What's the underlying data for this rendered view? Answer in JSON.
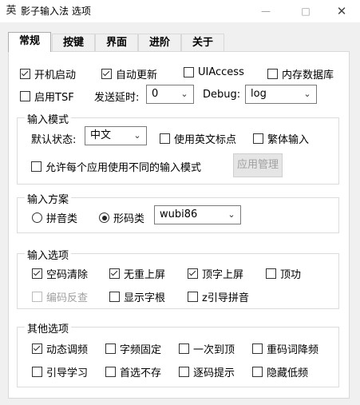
{
  "window": {
    "title": "影子输入法 选项",
    "icon": "app-logo-icon",
    "controls": {
      "minimize": "—",
      "maximize": "□",
      "close": "✕"
    }
  },
  "tabs": [
    {
      "label": "常规",
      "active": true
    },
    {
      "label": "按键",
      "active": false
    },
    {
      "label": "界面",
      "active": false
    },
    {
      "label": "进阶",
      "active": false
    },
    {
      "label": "关于",
      "active": false
    }
  ],
  "general": {
    "startup": {
      "label": "开机启动",
      "checked": true
    },
    "auto_update": {
      "label": "自动更新",
      "checked": true
    },
    "uiaccess": {
      "label": "UIAccess",
      "checked": false
    },
    "memory_db": {
      "label": "内存数据库",
      "checked": false
    },
    "enable_tsf": {
      "label": "启用TSF",
      "checked": false
    },
    "send_delay_label": "发送延时:",
    "send_delay_value": "0",
    "debug_label": "Debug:",
    "debug_value": "log"
  },
  "input_mode": {
    "title": "输入模式",
    "default_state_label": "默认状态:",
    "default_state_value": "中文",
    "english_punct": {
      "label": "使用英文标点",
      "checked": false
    },
    "traditional": {
      "label": "繁体输入",
      "checked": false
    },
    "per_app_mode": {
      "label": "允许每个应用使用不同的输入模式",
      "checked": false
    },
    "app_manage_button": "应用管理"
  },
  "input_scheme": {
    "title": "输入方案",
    "pinyin": {
      "label": "拼音类",
      "selected": false
    },
    "shape": {
      "label": "形码类",
      "selected": true
    },
    "scheme_value": "wubi86"
  },
  "input_options": {
    "title": "输入选项",
    "empty_clear": {
      "label": "空码清除",
      "checked": true
    },
    "no_dup_commit": {
      "label": "无重上屏",
      "checked": true
    },
    "top_char_commit": {
      "label": "顶字上屏",
      "checked": true
    },
    "top_function": {
      "label": "顶功",
      "checked": false
    },
    "code_reverse": {
      "label": "编码反查",
      "checked": false,
      "disabled": true
    },
    "show_root": {
      "label": "显示字根",
      "checked": false
    },
    "z_pinyin": {
      "label": "z引导拼音",
      "checked": false
    }
  },
  "other_options": {
    "title": "其他选项",
    "dynamic_freq": {
      "label": "动态调频",
      "checked": true
    },
    "fixed_freq": {
      "label": "字频固定",
      "checked": false
    },
    "once_top": {
      "label": "一次到顶",
      "checked": false
    },
    "dup_lower": {
      "label": "重码词降频",
      "checked": false
    },
    "guide_learn": {
      "label": "引导学习",
      "checked": false
    },
    "first_no_save": {
      "label": "首选不存",
      "checked": false
    },
    "step_hint": {
      "label": "逐码提示",
      "checked": false
    },
    "hide_low_freq": {
      "label": "隐藏低频",
      "checked": false
    }
  }
}
